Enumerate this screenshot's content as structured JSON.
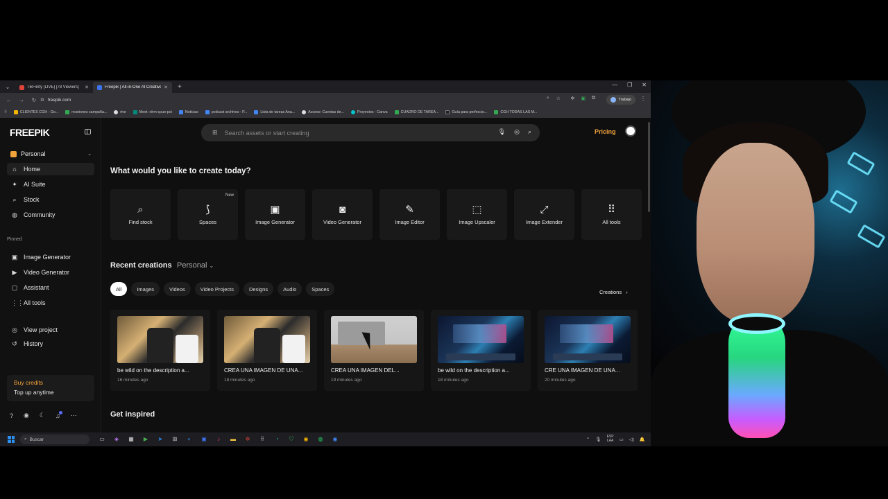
{
  "browser": {
    "tabs": [
      {
        "title": "TikFinity [LIVE] [78 Viewers]",
        "fav_color": "#e0453a"
      },
      {
        "title": "Freepik | All-in-One AI Creative",
        "fav_color": "#3d74f2"
      }
    ],
    "url": "freepik.com",
    "profile_label": "Trabajo",
    "bookmarks": [
      {
        "label": "CLIENTES CGH - Go...",
        "color": "#f4b400"
      },
      {
        "label": "reuniones campaña...",
        "color": "#34a853"
      },
      {
        "label": "rive",
        "color": "#ddd"
      },
      {
        "label": "Meet: nhm-cpuo-pct",
        "color": "#00897b"
      },
      {
        "label": "Noticias",
        "color": "#4285f4"
      },
      {
        "label": "podcast archivos - P...",
        "color": "#4285f4"
      },
      {
        "label": "Lista de tareas Ana...",
        "color": "#4285f4"
      },
      {
        "label": "Acceso: Cuentas de...",
        "color": "#ddd"
      },
      {
        "label": "Proyectos - Canva",
        "color": "#00c4cc"
      },
      {
        "label": "CUADRO DE TAREA...",
        "color": "#34a853"
      },
      {
        "label": "Guía para perfeccio...",
        "color": "#222"
      },
      {
        "label": "CGH TODAS LAS M...",
        "color": "#34a853"
      }
    ]
  },
  "sidebar": {
    "logo": "FREEPIK",
    "workspace": "Personal",
    "nav": [
      {
        "label": "Home",
        "icon": "⌂"
      },
      {
        "label": "AI Suite",
        "icon": "✦"
      },
      {
        "label": "Stock",
        "icon": "⌕"
      },
      {
        "label": "Community",
        "icon": "◍"
      }
    ],
    "pinned_label": "Pinned",
    "pinned": [
      {
        "label": "Image Generator",
        "icon": "▣"
      },
      {
        "label": "Video Generator",
        "icon": "▶"
      },
      {
        "label": "Assistant",
        "icon": "▢"
      },
      {
        "label": "All tools",
        "icon": "⋮⋮"
      }
    ],
    "extra": [
      {
        "label": "View project",
        "icon": "◎"
      },
      {
        "label": "History",
        "icon": "↺"
      }
    ],
    "credits": {
      "title": "Buy credits",
      "subtitle": "Top up anytime"
    }
  },
  "header": {
    "search_placeholder": "Search assets or start creating",
    "pricing": "Pricing"
  },
  "main": {
    "create_heading": "What would you like to create today?",
    "tools": [
      {
        "label": "Find stock",
        "icon": "⌕",
        "badge": ""
      },
      {
        "label": "Spaces",
        "icon": "⟆",
        "badge": "New"
      },
      {
        "label": "Image Generator",
        "icon": "▣",
        "badge": ""
      },
      {
        "label": "Video Generator",
        "icon": "◙",
        "badge": ""
      },
      {
        "label": "Image Editor",
        "icon": "✎",
        "badge": ""
      },
      {
        "label": "Image Upscaler",
        "icon": "⬚",
        "badge": ""
      },
      {
        "label": "Image Extender",
        "icon": "⤢",
        "badge": ""
      },
      {
        "label": "All tools",
        "icon": "⠿",
        "badge": ""
      }
    ],
    "recent_heading": "Recent creations",
    "recent_scope": "Personal",
    "filters": [
      "All",
      "Images",
      "Videos",
      "Video Projects",
      "Designs",
      "Audio",
      "Spaces"
    ],
    "creations_link": "Creations",
    "cards": [
      {
        "title": "be wild on the description a...",
        "time": "16 minutes ago",
        "thumb": "studio"
      },
      {
        "title": "CREA UNA IMAGEN DE UNA...",
        "time": "18 minutes ago",
        "thumb": "studio"
      },
      {
        "title": "CREA UNA IMAGEN DEL...",
        "time": "19 minutes ago",
        "thumb": "desk"
      },
      {
        "title": "be wild on the description a...",
        "time": "18 minutes ago",
        "thumb": "tech"
      },
      {
        "title": "CRE UNA IMAGEN DE UNA...",
        "time": "20 minutes ago",
        "thumb": "tech"
      }
    ],
    "inspired_heading": "Get inspired"
  },
  "taskbar": {
    "search_label": "Buscar",
    "lang_top": "ESP",
    "lang_bottom": "LAA"
  },
  "colors": {
    "accent": "#f3a33c",
    "background": "#0f0f0f",
    "card": "#191919"
  }
}
